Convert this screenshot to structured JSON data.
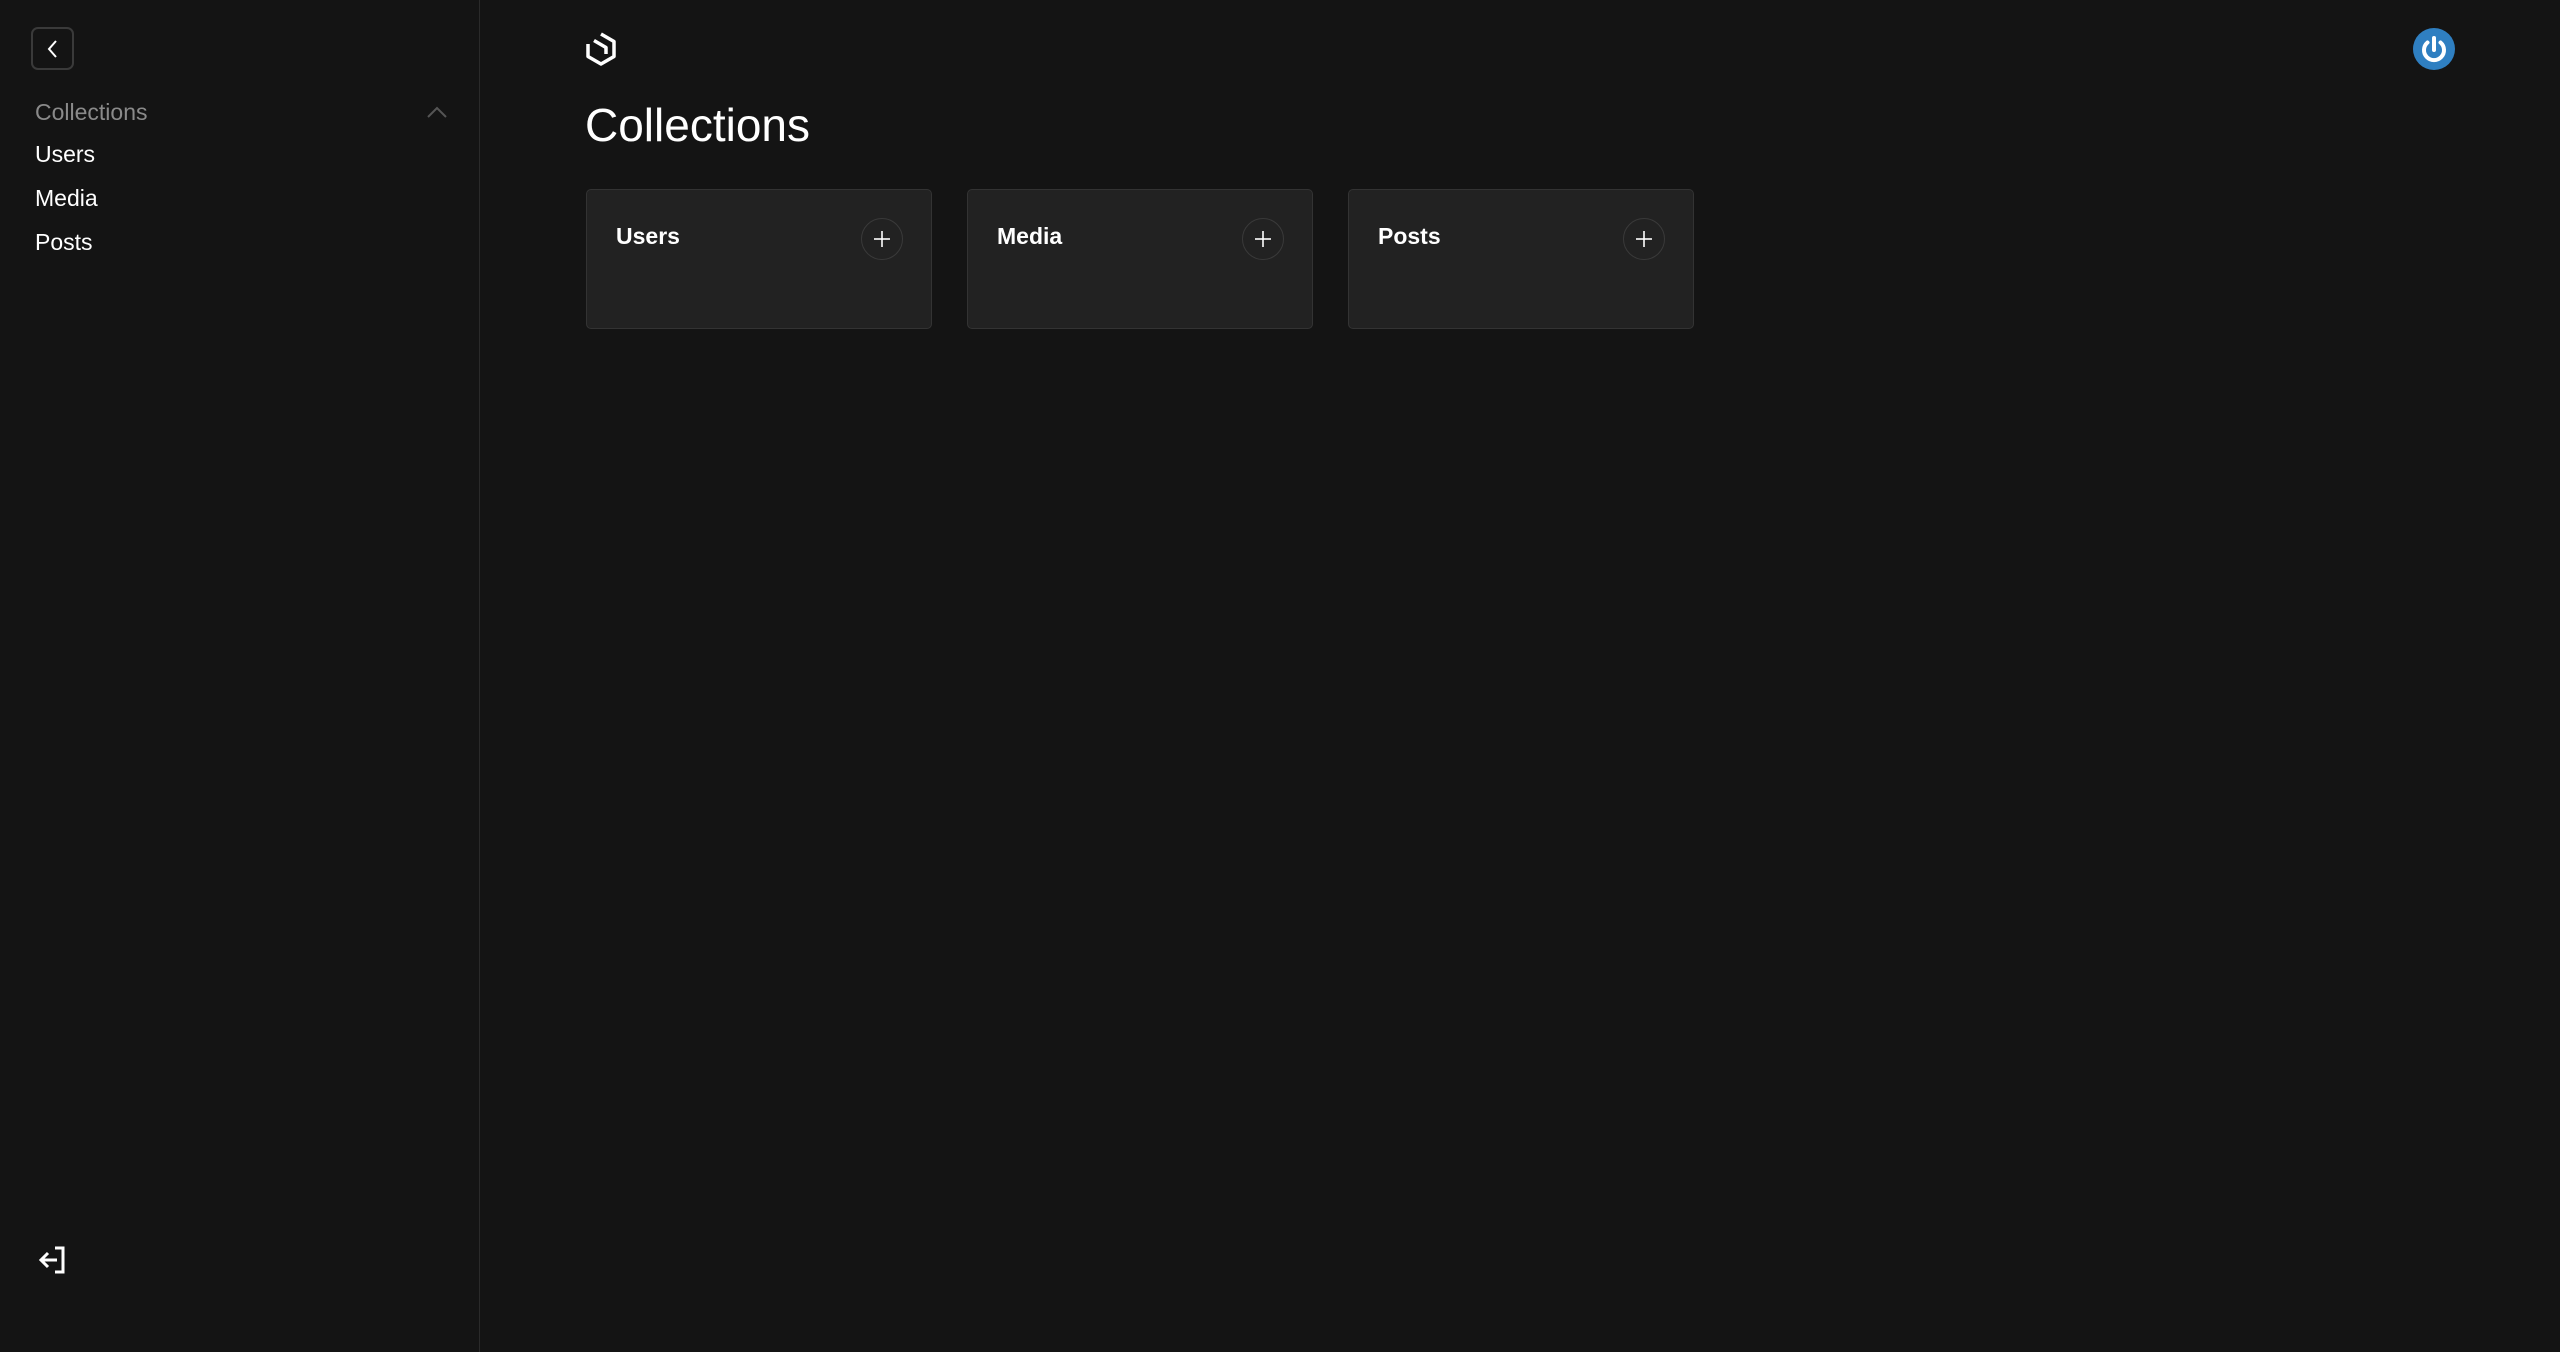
{
  "sidebar": {
    "back_button_icon": "chevron-left-icon",
    "group": {
      "label": "Collections",
      "expanded": true,
      "toggle_icon": "chevron-up-icon",
      "items": [
        {
          "label": "Users"
        },
        {
          "label": "Media"
        },
        {
          "label": "Posts"
        }
      ]
    },
    "logout_icon": "logout-icon"
  },
  "header": {
    "logo_icon": "logo-icon",
    "avatar_icon": "power-avatar-icon",
    "avatar_color": "#2f7fc1"
  },
  "main": {
    "title": "Collections",
    "cards": [
      {
        "title": "Users",
        "add_icon": "plus-icon"
      },
      {
        "title": "Media",
        "add_icon": "plus-icon"
      },
      {
        "title": "Posts",
        "add_icon": "plus-icon"
      }
    ]
  },
  "colors": {
    "background": "#141414",
    "card_background": "#222222",
    "border": "#333333",
    "muted_text": "#8a8a8a"
  }
}
